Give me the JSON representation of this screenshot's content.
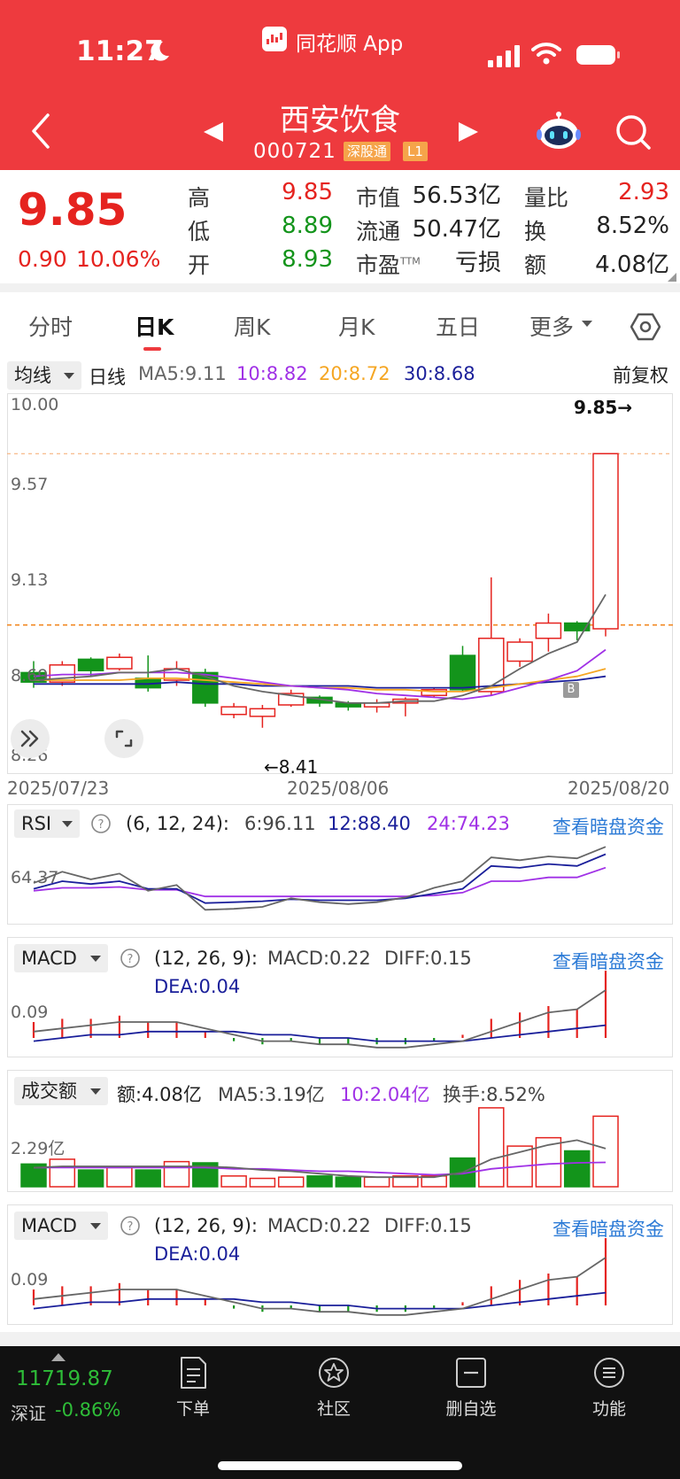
{
  "status_bar": {
    "time": "11:27",
    "app_name": "同花顺 App"
  },
  "header": {
    "stock_name": "西安饮食",
    "stock_code": "000721",
    "tag_connect": "深股通",
    "tag_level": "L1"
  },
  "quote": {
    "price": "9.85",
    "change_abs": "0.90",
    "change_pct": "10.06%",
    "high_label": "高",
    "high": "9.85",
    "low_label": "低",
    "low": "8.89",
    "open_label": "开",
    "open": "8.93",
    "mktcap_label": "市值",
    "mktcap": "56.53亿",
    "float_label": "流通",
    "float": "50.47亿",
    "pe_label": "市盈",
    "pe_sup": "TTM",
    "pe": "亏损",
    "volratio_label": "量比",
    "volratio": "2.93",
    "turnover_label": "换",
    "turnover": "8.52%",
    "amount_label": "额",
    "amount": "4.08亿"
  },
  "tabs": [
    "分时",
    "日K",
    "周K",
    "月K",
    "五日",
    "更多"
  ],
  "active_tab": "日K",
  "ma_bar": {
    "selector": "均线",
    "period": "日线",
    "ma5": "MA5:9.11",
    "ma10": "10:8.82",
    "ma20": "20:8.72",
    "ma30": "30:8.68",
    "adjust": "前复权"
  },
  "colors": {
    "up": "#e5231f",
    "down": "#13941b",
    "ma5": "#666666",
    "ma10": "#a031e6",
    "ma20": "#f5a623",
    "ma30": "#1a1f9a",
    "header": "#ee3a3e"
  },
  "kline": {
    "y_labels": [
      "10.00",
      "9.57",
      "9.13",
      "8.69",
      "8.26"
    ],
    "max_label": "9.85→",
    "min_label": "←8.41",
    "dates": [
      "2025/07/23",
      "2025/08/06",
      "2025/08/20"
    ],
    "marker": "B"
  },
  "rsi": {
    "selector": "RSI",
    "params": "(6, 12, 24):",
    "v6": "6:96.11",
    "v12": "12:88.40",
    "v24": "24:74.23",
    "link": "查看暗盘资金",
    "y_label": "64.37"
  },
  "macd": {
    "selector": "MACD",
    "params": "(12, 26, 9):",
    "macd": "MACD:0.22",
    "diff": "DIFF:0.15",
    "dea": "DEA:0.04",
    "link": "查看暗盘资金",
    "y_label": "0.09"
  },
  "amount_panel": {
    "selector": "成交额",
    "amount": "额:4.08亿",
    "ma5": "MA5:3.19亿",
    "ma10": "10:2.04亿",
    "turnover": "换手:8.52%",
    "y_label": "2.29亿"
  },
  "macd2": {
    "selector": "MACD",
    "params": "(12, 26, 9):",
    "macd": "MACD:0.22",
    "diff": "DIFF:0.15",
    "dea": "DEA:0.04",
    "link": "查看暗盘资金",
    "y_label": "0.09"
  },
  "chart_data": {
    "type": "candlestick",
    "dates_shown": [
      "2025/07/23",
      "2025/08/06",
      "2025/08/20"
    ],
    "ylim": [
      8.26,
      10.0
    ],
    "candles": [
      {
        "o": 8.7,
        "c": 8.65,
        "h": 8.76,
        "l": 8.62
      },
      {
        "o": 8.65,
        "c": 8.74,
        "h": 8.76,
        "l": 8.63
      },
      {
        "o": 8.77,
        "c": 8.71,
        "h": 8.78,
        "l": 8.68
      },
      {
        "o": 8.72,
        "c": 8.78,
        "h": 8.8,
        "l": 8.71
      },
      {
        "o": 8.67,
        "c": 8.62,
        "h": 8.79,
        "l": 8.6
      },
      {
        "o": 8.66,
        "c": 8.72,
        "h": 8.76,
        "l": 8.63
      },
      {
        "o": 8.7,
        "c": 8.54,
        "h": 8.72,
        "l": 8.52
      },
      {
        "o": 8.48,
        "c": 8.52,
        "h": 8.54,
        "l": 8.46
      },
      {
        "o": 8.47,
        "c": 8.51,
        "h": 8.53,
        "l": 8.41
      },
      {
        "o": 8.53,
        "c": 8.59,
        "h": 8.61,
        "l": 8.52
      },
      {
        "o": 8.57,
        "c": 8.54,
        "h": 8.58,
        "l": 8.52
      },
      {
        "o": 8.54,
        "c": 8.52,
        "h": 8.55,
        "l": 8.5
      },
      {
        "o": 8.52,
        "c": 8.54,
        "h": 8.56,
        "l": 8.49
      },
      {
        "o": 8.54,
        "c": 8.56,
        "h": 8.57,
        "l": 8.47
      },
      {
        "o": 8.58,
        "c": 8.61,
        "h": 8.62,
        "l": 8.57
      },
      {
        "o": 8.79,
        "c": 8.61,
        "h": 8.84,
        "l": 8.6
      },
      {
        "o": 8.6,
        "c": 8.88,
        "h": 9.2,
        "l": 8.58
      },
      {
        "o": 8.76,
        "c": 8.86,
        "h": 8.88,
        "l": 8.73
      },
      {
        "o": 8.88,
        "c": 8.96,
        "h": 9.01,
        "l": 8.81
      },
      {
        "o": 8.96,
        "c": 8.92,
        "h": 8.97,
        "l": 8.87
      },
      {
        "o": 8.93,
        "c": 9.85,
        "h": 9.85,
        "l": 8.89
      }
    ],
    "ma5": [
      8.66,
      8.67,
      8.68,
      8.7,
      8.7,
      8.72,
      8.68,
      8.63,
      8.6,
      8.58,
      8.56,
      8.54,
      8.54,
      8.55,
      8.55,
      8.58,
      8.63,
      8.72,
      8.8,
      8.86,
      9.11
    ],
    "ma10": [
      8.68,
      8.69,
      8.69,
      8.7,
      8.7,
      8.7,
      8.69,
      8.67,
      8.65,
      8.63,
      8.62,
      8.61,
      8.59,
      8.58,
      8.57,
      8.56,
      8.58,
      8.62,
      8.66,
      8.71,
      8.82
    ],
    "ma20": [
      8.66,
      8.66,
      8.66,
      8.66,
      8.67,
      8.67,
      8.66,
      8.65,
      8.64,
      8.63,
      8.62,
      8.62,
      8.61,
      8.61,
      8.6,
      8.6,
      8.62,
      8.64,
      8.66,
      8.68,
      8.72
    ],
    "ma30": [
      8.64,
      8.64,
      8.64,
      8.64,
      8.64,
      8.65,
      8.64,
      8.64,
      8.63,
      8.63,
      8.63,
      8.63,
      8.62,
      8.62,
      8.62,
      8.62,
      8.63,
      8.64,
      8.65,
      8.66,
      8.68
    ],
    "rsi": {
      "rsi6": [
        58,
        70,
        62,
        68,
        50,
        56,
        30,
        31,
        33,
        42,
        38,
        36,
        38,
        43,
        53,
        60,
        85,
        82,
        86,
        84,
        96.11
      ],
      "rsi12": [
        52,
        60,
        57,
        60,
        52,
        52,
        37,
        38,
        39,
        41,
        40,
        40,
        40,
        42,
        47,
        52,
        76,
        74,
        78,
        76,
        88.4
      ],
      "rsi24": [
        50,
        53,
        53,
        54,
        51,
        51,
        44,
        44,
        44,
        44,
        44,
        44,
        44,
        44,
        45,
        48,
        60,
        60,
        64,
        64,
        74.23
      ]
    },
    "macd": {
      "bars": [
        0.05,
        0.06,
        0.06,
        0.07,
        0.05,
        0.05,
        0.02,
        -0.01,
        -0.02,
        -0.01,
        -0.02,
        -0.02,
        -0.02,
        -0.02,
        -0.01,
        0.01,
        0.06,
        0.08,
        0.1,
        0.09,
        0.22
      ],
      "diff": [
        0.02,
        0.03,
        0.04,
        0.05,
        0.05,
        0.05,
        0.03,
        0.01,
        -0.01,
        -0.01,
        -0.02,
        -0.02,
        -0.03,
        -0.03,
        -0.02,
        -0.01,
        0.02,
        0.05,
        0.08,
        0.09,
        0.15
      ],
      "dea": [
        -0.01,
        0.0,
        0.01,
        0.01,
        0.02,
        0.02,
        0.02,
        0.02,
        0.01,
        0.01,
        0.0,
        0.0,
        -0.01,
        -0.01,
        -0.01,
        -0.01,
        0.0,
        0.01,
        0.02,
        0.03,
        0.04
      ]
    },
    "amount": {
      "values": [
        1.9,
        2.3,
        1.4,
        1.6,
        1.4,
        2.1,
        2.0,
        0.9,
        0.7,
        0.8,
        0.9,
        0.8,
        0.8,
        0.9,
        0.9,
        2.4,
        6.6,
        3.4,
        4.1,
        3.0,
        5.9
      ],
      "ma5": [
        1.6,
        1.7,
        1.7,
        1.7,
        1.7,
        1.7,
        1.7,
        1.6,
        1.4,
        1.3,
        1.1,
        0.9,
        0.8,
        0.8,
        0.8,
        1.2,
        2.3,
        2.9,
        3.5,
        3.9,
        3.19
      ],
      "ma10": [
        1.6,
        1.6,
        1.6,
        1.6,
        1.6,
        1.6,
        1.6,
        1.5,
        1.5,
        1.4,
        1.3,
        1.3,
        1.2,
        1.1,
        1.0,
        1.1,
        1.5,
        1.7,
        1.9,
        2.0,
        2.04
      ]
    }
  }
}
